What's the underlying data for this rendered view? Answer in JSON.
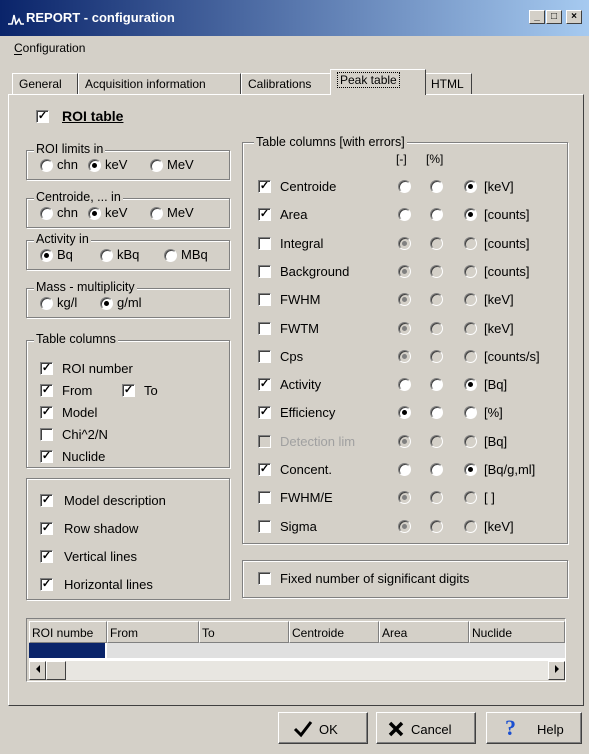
{
  "window": {
    "title": "REPORT - configuration",
    "minimize": "_",
    "maximize": "□",
    "close": "×"
  },
  "menu": {
    "configuration": "Configuration"
  },
  "tabs": [
    "General",
    "Acquisition information",
    "Calibrations",
    "Peak table",
    "HTML"
  ],
  "roi_table": {
    "label": "ROI table",
    "checked": true
  },
  "roi_limits": {
    "title": "ROI limits in",
    "options": [
      "chn",
      "keV",
      "MeV"
    ],
    "selected": "keV"
  },
  "centroide": {
    "title": "Centroide, ... in",
    "options": [
      "chn",
      "keV",
      "MeV"
    ],
    "selected": "keV"
  },
  "activity": {
    "title": "Activity in",
    "options": [
      "Bq",
      "kBq",
      "MBq"
    ],
    "selected": "Bq"
  },
  "mass": {
    "title": "Mass - multiplicity",
    "options": [
      "kg/l",
      "g/ml"
    ],
    "selected": "g/ml"
  },
  "table_columns": {
    "title": "Table columns",
    "roi_number": "ROI number",
    "from": "From",
    "to": "To",
    "model": "Model",
    "chi": "Chi^2/N",
    "nuclide": "Nuclide"
  },
  "display": {
    "model_description": "Model description",
    "row_shadow": "Row shadow",
    "vertical_lines": "Vertical lines",
    "horizontal_lines": "Horizontal lines"
  },
  "table_columns_err": {
    "title": "Table columns  [with errors]",
    "col1": "[-]",
    "col2": "[%]"
  },
  "rows": [
    {
      "label": "Centroide",
      "checked": true,
      "disabled": false,
      "sel": 2,
      "radios_disabled": false,
      "unit": "[keV]"
    },
    {
      "label": "Area",
      "checked": true,
      "disabled": false,
      "sel": 2,
      "radios_disabled": false,
      "unit": "[counts]"
    },
    {
      "label": "Integral",
      "checked": false,
      "disabled": false,
      "sel": 0,
      "radios_disabled": true,
      "unit": "[counts]"
    },
    {
      "label": "Background",
      "checked": false,
      "disabled": false,
      "sel": 0,
      "radios_disabled": true,
      "unit": "[counts]"
    },
    {
      "label": "FWHM",
      "checked": false,
      "disabled": false,
      "sel": 0,
      "radios_disabled": true,
      "unit": "[keV]"
    },
    {
      "label": "FWTM",
      "checked": false,
      "disabled": false,
      "sel": 0,
      "radios_disabled": true,
      "unit": "[keV]"
    },
    {
      "label": "Cps",
      "checked": false,
      "disabled": false,
      "sel": 0,
      "radios_disabled": true,
      "unit": "[counts/s]"
    },
    {
      "label": "Activity",
      "checked": true,
      "disabled": false,
      "sel": 2,
      "radios_disabled": false,
      "unit": "[Bq]"
    },
    {
      "label": "Efficiency",
      "checked": true,
      "disabled": false,
      "sel": 0,
      "radios_disabled": false,
      "unit": "[%]"
    },
    {
      "label": "Detection lim",
      "checked": false,
      "disabled": true,
      "sel": 0,
      "radios_disabled": true,
      "unit": "[Bq]"
    },
    {
      "label": "Concent.",
      "checked": true,
      "disabled": false,
      "sel": 2,
      "radios_disabled": false,
      "unit": "[Bq/g,ml]"
    },
    {
      "label": "FWHM/E",
      "checked": false,
      "disabled": false,
      "sel": 0,
      "radios_disabled": true,
      "unit": "[ ]"
    },
    {
      "label": "Sigma",
      "checked": false,
      "disabled": false,
      "sel": 0,
      "radios_disabled": true,
      "unit": "[keV]"
    }
  ],
  "fixed_digits": "Fixed number of significant digits",
  "grid_headers": [
    "ROI numbe",
    "From",
    "To",
    "Centroide",
    "Area",
    "Nuclide"
  ],
  "buttons": {
    "ok": "OK",
    "cancel": "Cancel",
    "help": "Help"
  },
  "colors": {
    "title_start": "#0a246a",
    "title_end": "#a6caf0",
    "face": "#d4d0c8",
    "selected_cell": "#0a246a"
  },
  "icons": {
    "ok": "checkmark-icon",
    "cancel": "x-icon",
    "help": "question-icon"
  }
}
